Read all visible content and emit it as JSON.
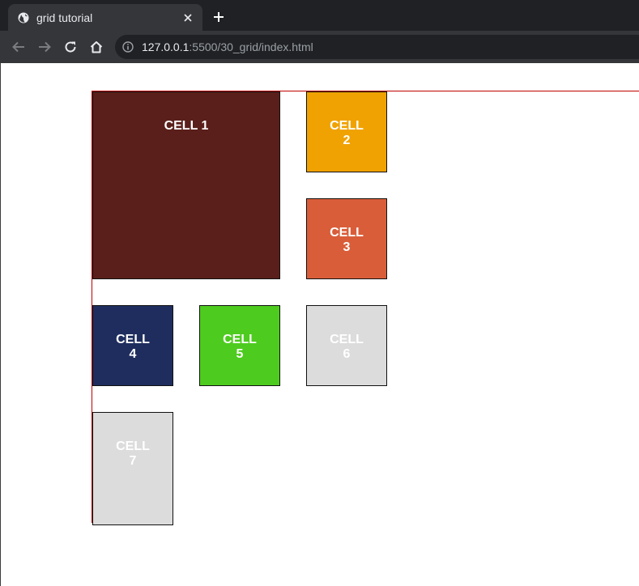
{
  "browser": {
    "tab": {
      "title": "grid tutorial",
      "favicon": "globe-icon",
      "close_icon": "close-icon"
    },
    "new_tab_icon": "plus-icon",
    "nav": {
      "back_icon": "arrow-left-icon",
      "forward_icon": "arrow-right-icon",
      "reload_icon": "reload-icon",
      "home_icon": "home-icon"
    },
    "address": {
      "info_icon": "info-icon",
      "host": "127.0.0.1",
      "rest": ":5500/30_grid/index.html"
    }
  },
  "page": {
    "grid_border_color": "#c00000",
    "cells": [
      {
        "label": "CELL 1",
        "color": "#5a1f1a"
      },
      {
        "label": "CELL 2",
        "color": "#f0a202"
      },
      {
        "label": "CELL 3",
        "color": "#d95d39"
      },
      {
        "label": "CELL 4",
        "color": "#1e2d5e"
      },
      {
        "label": "CELL 5",
        "color": "#4ecb1f"
      },
      {
        "label": "CELL 6",
        "color": "#dcdcdc"
      },
      {
        "label": "CELL 7",
        "color": "#dcdcdc"
      }
    ]
  }
}
